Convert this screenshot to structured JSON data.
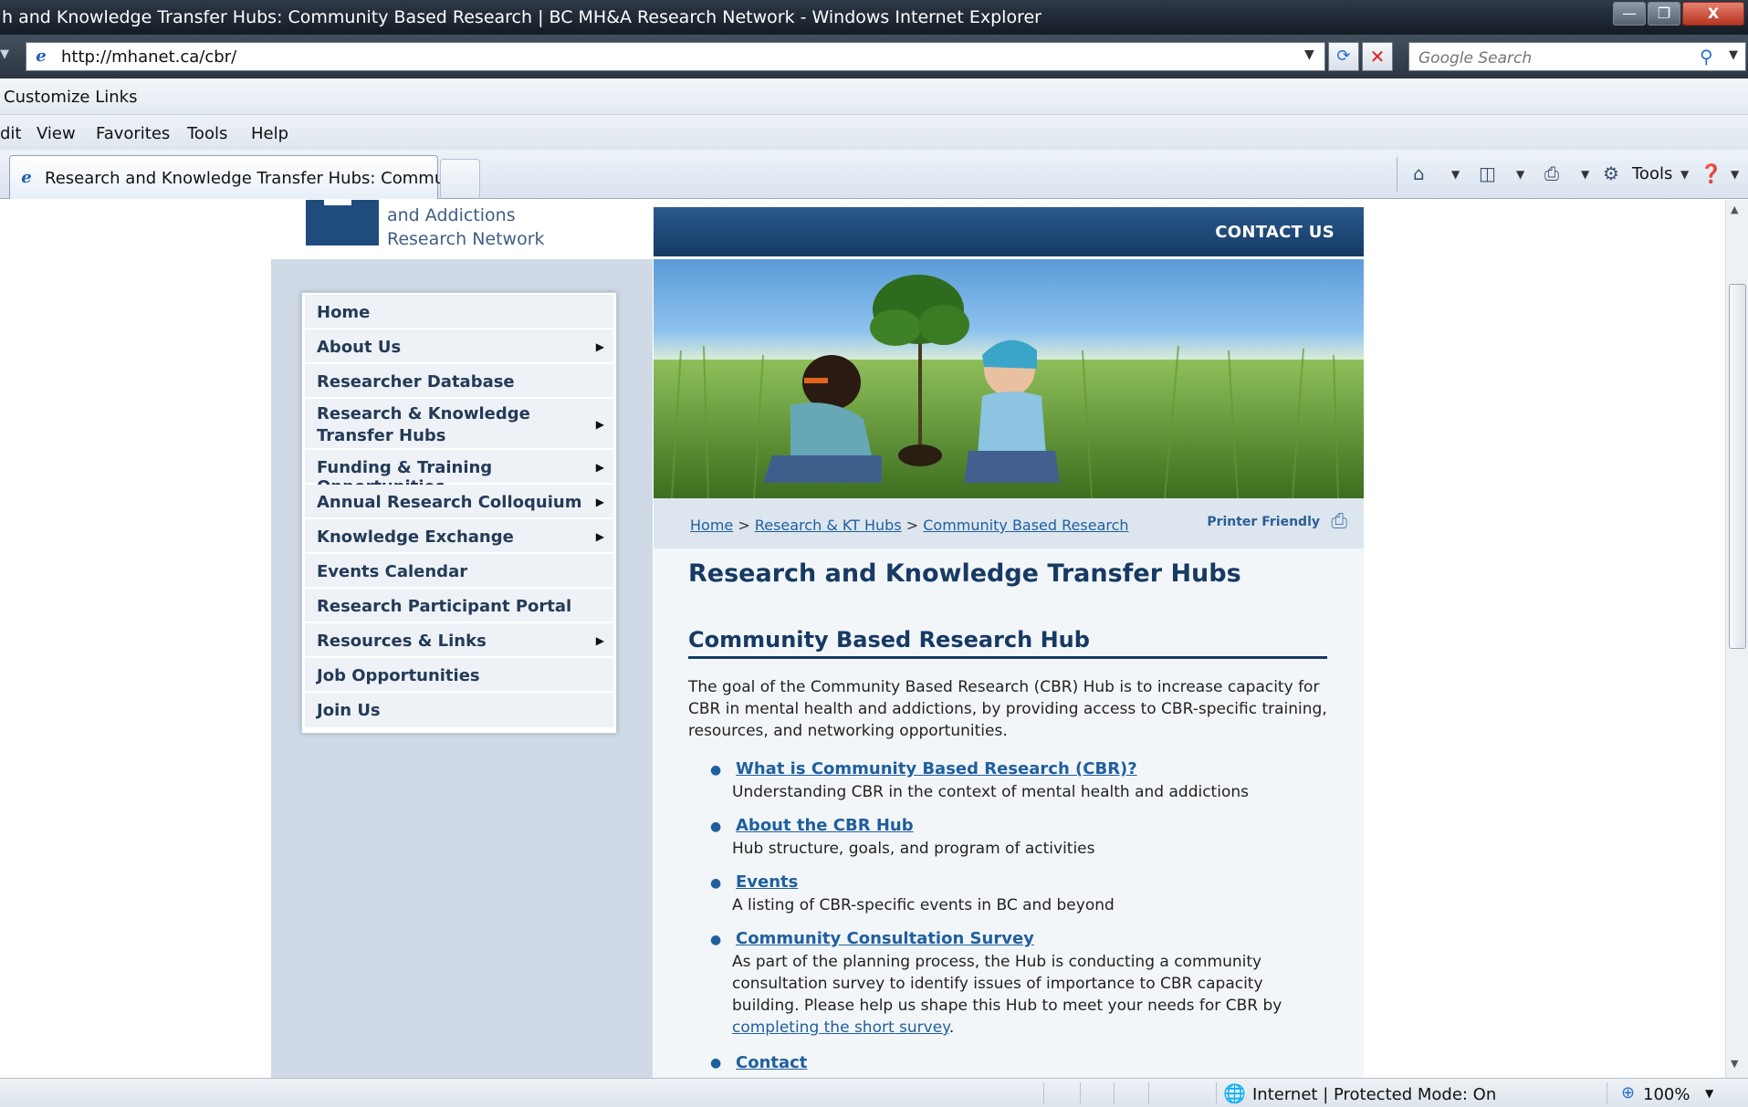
{
  "window": {
    "title": "h and Knowledge Transfer Hubs: Community Based Research | BC MH&A Research Network - Windows Internet Explorer",
    "minimize": "—",
    "restore": "❐",
    "close": "X"
  },
  "address_bar": {
    "url": "http://mhanet.ca/cbr/",
    "search_placeholder": "Google Search"
  },
  "links_bar": {
    "label": "Customize Links"
  },
  "menu": [
    "dit",
    "View",
    "Favorites",
    "Tools",
    "Help"
  ],
  "tab": {
    "label": "Research and Knowledge Transfer Hubs: Commu..."
  },
  "command_bar": {
    "tools_label": "Tools"
  },
  "site": {
    "logo_line1": "and Addictions",
    "logo_line2": "Research Network",
    "contact_label": "CONTACT US"
  },
  "nav": [
    {
      "label": "Home",
      "has_submenu": false
    },
    {
      "label": "About Us",
      "has_submenu": true
    },
    {
      "label": "Researcher Database",
      "has_submenu": false
    },
    {
      "label": "Research & Knowledge",
      "label2": "Transfer Hubs",
      "has_submenu": true
    },
    {
      "label": "Funding & Training Opportunities",
      "has_submenu": true
    },
    {
      "label": "Annual Research Colloquium",
      "has_submenu": true
    },
    {
      "label": "Knowledge Exchange",
      "has_submenu": true
    },
    {
      "label": "Events Calendar",
      "has_submenu": false
    },
    {
      "label": "Research Participant Portal",
      "has_submenu": false
    },
    {
      "label": "Resources & Links",
      "has_submenu": true
    },
    {
      "label": "Job Opportunities",
      "has_submenu": false
    },
    {
      "label": "Join Us",
      "has_submenu": false
    }
  ],
  "breadcrumb": {
    "items": [
      "Home",
      "Research & KT Hubs",
      "Community Based Research"
    ],
    "separator": ">",
    "printer_friendly": "Printer Friendly"
  },
  "content": {
    "page_title": "Research and Knowledge Transfer Hubs",
    "section_title": "Community Based Research Hub",
    "intro": "The goal of the Community Based Research (CBR) Hub is to increase capacity for CBR in mental health and addictions, by providing access to CBR-specific training, resources, and networking opportunities.",
    "items": [
      {
        "link": "What is Community Based Research (CBR)?",
        "desc": "Understanding CBR in the context of mental health and addictions"
      },
      {
        "link": "About the CBR Hub",
        "desc": "Hub structure, goals, and program of activities"
      },
      {
        "link": "Events",
        "desc": "A listing of CBR-specific events in BC and beyond"
      },
      {
        "link": "Community Consultation Survey",
        "desc": "As part of the planning process, the Hub is conducting a community consultation survey to identify issues of importance to CBR capacity building. Please help us shape this Hub to meet your needs for CBR by",
        "desc_link": "completing the short survey",
        "desc_end": "."
      },
      {
        "link": "Contact",
        "desc": ""
      }
    ]
  },
  "status_bar": {
    "zone": "Internet | Protected Mode: On",
    "zoom": "100%"
  },
  "colors": {
    "header_blue": "#143a63",
    "link_blue": "#1f5f9e",
    "nav_text": "#243a58",
    "sidebar_bg": "#cfdae6"
  }
}
